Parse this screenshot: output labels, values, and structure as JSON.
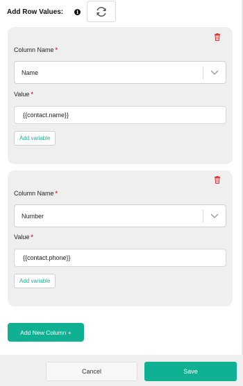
{
  "header": {
    "label": "Add Row Values:",
    "info_icon": "info-icon",
    "refresh_icon": "refresh-icon"
  },
  "rows": [
    {
      "column_label": "Column Name",
      "column_value": "Name",
      "value_label": "Value",
      "value_text": "{{contact.name}}",
      "add_variable_label": "Add variable"
    },
    {
      "column_label": "Column Name",
      "column_value": "Number",
      "value_label": "Value",
      "value_text": "{{contact.phone}}",
      "add_variable_label": "Add variable"
    }
  ],
  "required_marker": "*",
  "add_column_label": "Add New Column +",
  "footer": {
    "cancel_label": "Cancel",
    "save_label": "Save"
  },
  "colors": {
    "accent": "#10b193",
    "danger": "#e03131",
    "card_bg": "#efefef"
  }
}
